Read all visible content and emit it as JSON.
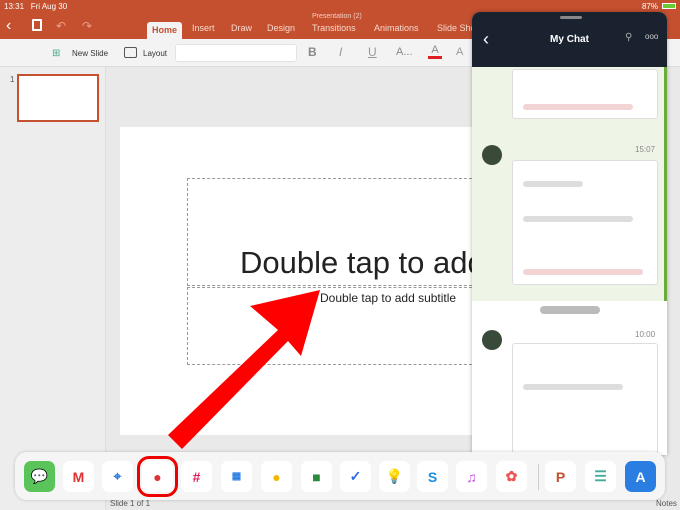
{
  "status": {
    "time": "13:31",
    "date": "Fri Aug 30",
    "battery": "87%"
  },
  "ribbon": {
    "doc_title": "Presentation (2)",
    "tabs": [
      "Home",
      "Insert",
      "Draw",
      "Design",
      "Transitions",
      "Animations",
      "Slide Show"
    ]
  },
  "toolbar": {
    "new_slide": "New Slide",
    "layout": "Layout",
    "bold": "B",
    "italic": "I",
    "underline": "U",
    "font_size": "A...",
    "font_color": "A",
    "accent": "#e02020"
  },
  "thumbs": {
    "number": "1"
  },
  "slide": {
    "title_placeholder": "Double tap to add title",
    "subtitle_placeholder": "Double tap to add subtitle"
  },
  "footer": {
    "slide_count": "Slide 1 of 1",
    "notes": "Notes"
  },
  "chat": {
    "title": "My Chat",
    "times": [
      "15:07",
      "10:00"
    ],
    "accent": "#6aab3a"
  },
  "dock": {
    "apps": [
      "Messages",
      "Gmail",
      "Safari",
      "Asana",
      "Slack",
      "Calendar",
      "Google Keep",
      "Classroom",
      "Tasks",
      "Keep Ideas",
      "Skype",
      "Music",
      "Photos",
      "PowerPoint",
      "Newsstand",
      "App Store"
    ]
  },
  "colors": {
    "brand": "#c5502f",
    "arrow": "#ff0000"
  }
}
